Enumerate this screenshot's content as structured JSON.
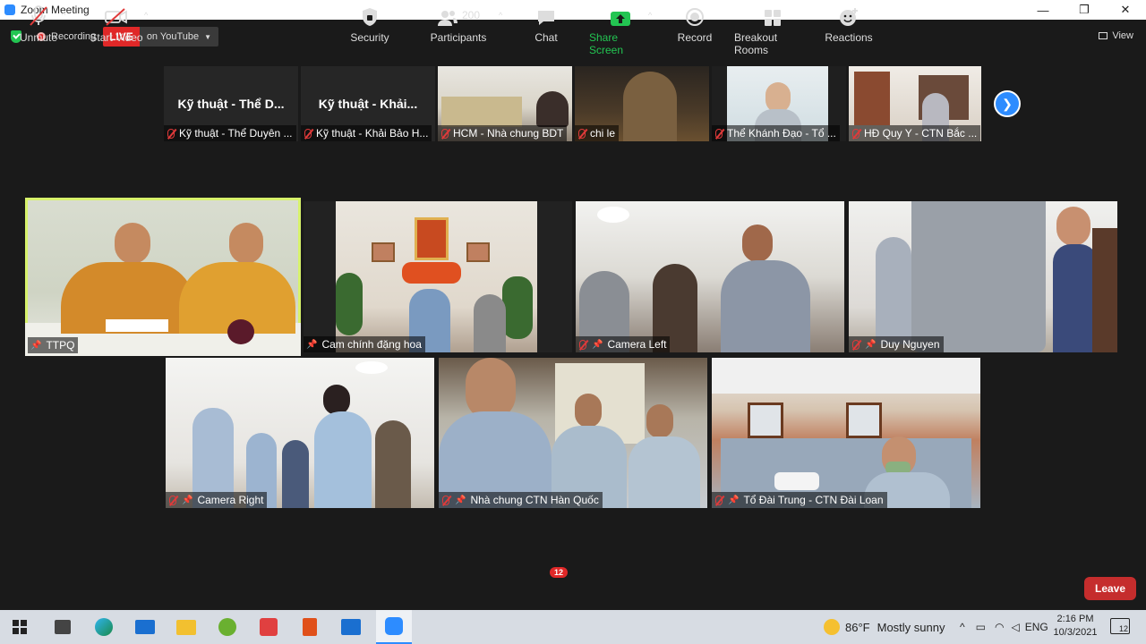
{
  "window": {
    "title": "Zoom Meeting"
  },
  "topbar": {
    "recording": "Recording",
    "live": "LIVE",
    "live_on": "on YouTube",
    "view": "View"
  },
  "strip": [
    {
      "big": "Kỹ thuật - Thể D...",
      "label": "Kỹ thuật - Thể Duyên ..."
    },
    {
      "big": "Kỹ thuật - Khải...",
      "label": "Kỹ thuật - Khải Bảo H..."
    },
    {
      "big": "",
      "label": "HCM - Nhà chung BDT"
    },
    {
      "big": "",
      "label": "chi le"
    },
    {
      "big": "",
      "label": "Thể Khánh Đạo - Tổ ..."
    },
    {
      "big": "",
      "label": "HĐ Quy Y - CTN Bắc ..."
    }
  ],
  "gallery": [
    {
      "label": "TTPQ"
    },
    {
      "label": "Cam chính đặng hoa"
    },
    {
      "label": "Camera Left"
    },
    {
      "label": "Duy Nguyen"
    },
    {
      "label": "Camera Right"
    },
    {
      "label": "Nhà chung CTN Hàn Quốc"
    },
    {
      "label": "Tổ Đài Trung  - CTN Đài Loan"
    }
  ],
  "toolbar": {
    "unmute": "Unmute",
    "start_video": "Start Video",
    "security": "Security",
    "participants": "Participants",
    "participants_count": "200",
    "chat": "Chat",
    "chat_badge": "12",
    "share_screen": "Share Screen",
    "record": "Record",
    "breakout_rooms": "Breakout Rooms",
    "reactions": "Reactions",
    "leave": "Leave"
  },
  "taskbar": {
    "weather_temp": "86°F",
    "weather_desc": "Mostly sunny",
    "lang": "ENG",
    "time": "2:16 PM",
    "date": "10/3/2021",
    "notif_count": "12"
  },
  "colors": {
    "live": "#e02828",
    "accent": "#2d8cff",
    "share": "#23c552",
    "active_speaker": "#d7f26b",
    "leave": "#c52d2d"
  }
}
